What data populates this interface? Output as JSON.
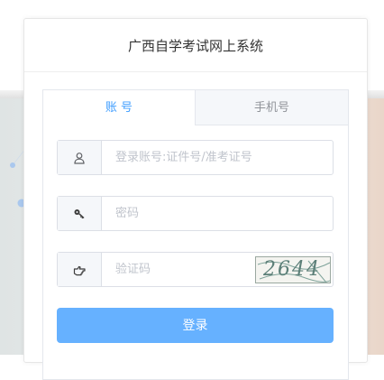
{
  "system": {
    "title": "广西自学考试网上系统"
  },
  "tabs": [
    {
      "label": "账 号",
      "active": true
    },
    {
      "label": "手机号",
      "active": false
    }
  ],
  "form": {
    "account": {
      "placeholder": "登录账号:证件号/准考证号",
      "value": "",
      "icon": "user-icon"
    },
    "password": {
      "placeholder": "密码",
      "value": "",
      "icon": "key-icon"
    },
    "captcha": {
      "placeholder": "验证码",
      "value": "",
      "icon": "hand-pointer-icon",
      "image_text": "2644"
    },
    "login_label": "登录"
  },
  "colors": {
    "accent": "#409eff",
    "button": "#66b1ff",
    "background_dots": "#aac8ee"
  }
}
